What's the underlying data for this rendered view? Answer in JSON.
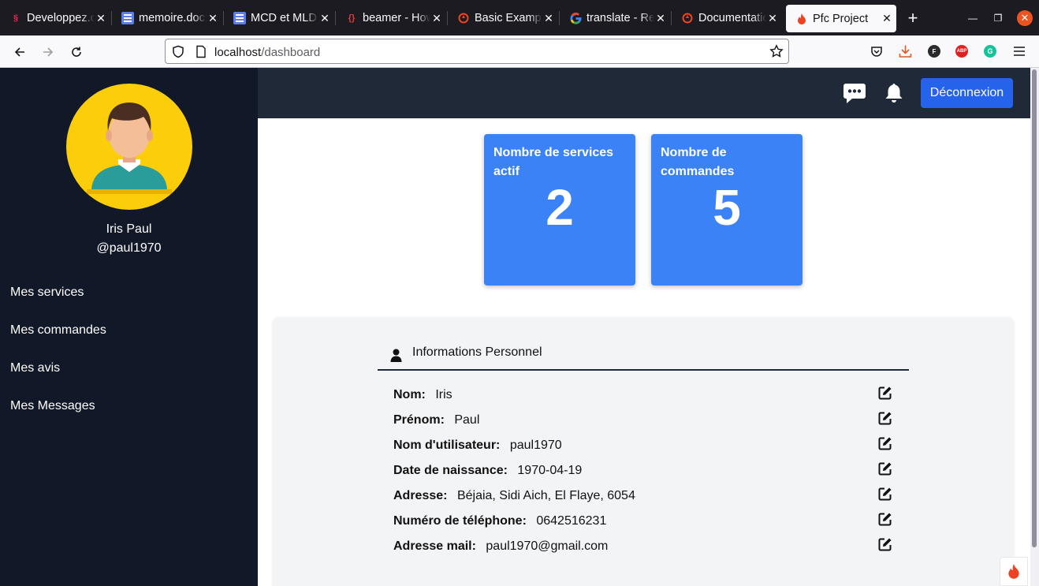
{
  "browser": {
    "tabs": [
      {
        "title": "Developpez.com",
        "icon": "developpez-icon"
      },
      {
        "title": "memoire.docx",
        "icon": "document-icon"
      },
      {
        "title": "MCD et MLD",
        "icon": "document-icon"
      },
      {
        "title": "beamer - How",
        "icon": "overleaf-icon"
      },
      {
        "title": "Basic Example",
        "icon": "codeigniter-icon"
      },
      {
        "title": "translate - Re",
        "icon": "google-icon"
      },
      {
        "title": "Documentation",
        "icon": "codeigniter-icon"
      },
      {
        "title": "Pfc Project",
        "icon": "codeigniter-icon"
      }
    ],
    "url_host": "localhost",
    "url_path": "/dashboard"
  },
  "sidebar": {
    "full_name": "Iris Paul",
    "username": "@paul1970",
    "links": [
      {
        "label": "Mes services"
      },
      {
        "label": "Mes commandes"
      },
      {
        "label": "Mes avis"
      },
      {
        "label": "Mes Messages"
      }
    ]
  },
  "topbar": {
    "logout_label": "Déconnexion"
  },
  "stats": [
    {
      "label": "Nombre de services actif",
      "value": "2"
    },
    {
      "label": "Nombre de commandes",
      "value": "5"
    }
  ],
  "info": {
    "title": "Informations Personnel",
    "rows": [
      {
        "label": "Nom:",
        "value": "Iris"
      },
      {
        "label": "Prénom:",
        "value": "Paul"
      },
      {
        "label": "Nom d'utilisateur:",
        "value": "paul1970"
      },
      {
        "label": "Date de naissance:",
        "value": "1970-04-19"
      },
      {
        "label": "Adresse:",
        "value": "Béjaia, Sidi Aich, El Flaye, 6054"
      },
      {
        "label": "Numéro de téléphone:",
        "value": "0642516231"
      },
      {
        "label": "Adresse mail:",
        "value": "paul1970@gmail.com"
      }
    ]
  },
  "colors": {
    "sidebar_bg": "#111827",
    "topbar_bg": "#1f2937",
    "card_blue": "#3b82f6",
    "button_blue": "#2563eb",
    "avatar_bg": "#fbcd0a",
    "panel_bg": "#f3f4f6"
  }
}
